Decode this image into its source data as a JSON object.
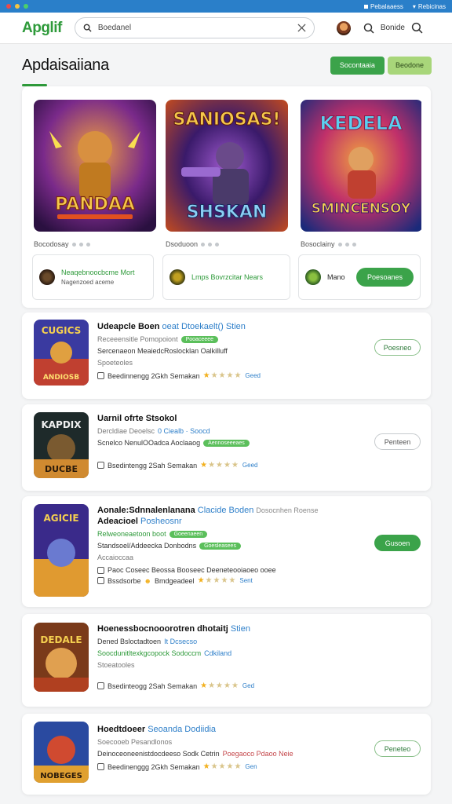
{
  "status_bar": {
    "dot_colors": [
      "#e94b4b",
      "#f5c542",
      "#4bcf6b"
    ],
    "right_items": [
      "Pebalaaess",
      "Rebicinas"
    ]
  },
  "topbar": {
    "logo": "Apglif",
    "search_value": "Boedanel",
    "account_label": "Bonide"
  },
  "page": {
    "title": "Apdaisaiiana",
    "primary_button": "Socontaaia",
    "secondary_button": "Beodone"
  },
  "featured": {
    "items": [
      {
        "banner_top": "",
        "banner_bottom": "PANDAA",
        "banner_sub": "",
        "caption": "Bocodosay",
        "sub_title": "Neaqebnoocbcme Mort",
        "sub_desc": "Nagenzoed aceme",
        "palette": [
          "#5a2a8a",
          "#e08a2a"
        ]
      },
      {
        "banner_top": "SANIOSAS!",
        "banner_bottom": "SHSKAN",
        "banner_sub": "",
        "caption": "Dsoduoon",
        "sub_title": "Lmps Bovrzcitar Nears",
        "sub_desc": "",
        "palette": [
          "#2a1a5a",
          "#c04a2a"
        ]
      },
      {
        "banner_top": "KEDELA",
        "banner_bottom": "SMINCENSOY",
        "banner_sub": "",
        "caption": "Bosoclainy",
        "sub_title": "Mano",
        "sub_desc": "",
        "install_label": "Poesoanes",
        "palette": [
          "#1a3a8a",
          "#c0305a"
        ]
      }
    ]
  },
  "apps": [
    {
      "name": "Udeapcle Boen",
      "name_extra": "oeat Dtoekaelt() Stien",
      "line1": "Receeensitle Pomopoiont",
      "pill1": "Pooaceeee",
      "line2": "Sercenaeon MeaiedcRoslocklan Oalkilluff",
      "line3": "Spoeteoles",
      "meta": "Beedinnengg 2Gkh Semakan",
      "stars_full": 1,
      "rating_text": "Geed",
      "install": "Poesneo",
      "install_style": "outline",
      "icon_text": "CUGICS",
      "icon_sub": "ANDIOSB",
      "palette": [
        "#2a3a8a",
        "#d04030"
      ]
    },
    {
      "name": "Uarnil ofrte Stsokol",
      "name_extra": "",
      "line1": "Dercldiae Deoelsc",
      "line1_blue": "0 Ciealb · Soocd",
      "line2": "Scnelco NenulOOadca Aoclaaog",
      "pill2": "Aennoseeeaes",
      "line3": "",
      "meta": "Bsedintengg 2Sah Semakan",
      "stars_full": 1,
      "rating_text": "Geed",
      "install": "Penteen",
      "install_style": "outline-gray",
      "icon_text": "KAPDIX",
      "icon_sub": "DUCBE",
      "palette": [
        "#1a2a2a",
        "#d08a30"
      ]
    },
    {
      "name": "Aonale:Sdnnalenlanana",
      "name_extra": "Clacide Boden",
      "name_grey": "Dosocnhen Roense",
      "name2": "Adeacioel",
      "name2_extra": "Posheosnr",
      "line1": "Relweoneaetoon boot",
      "pill1": "Goeenaeen",
      "line2": "Standsoel/Addeecka Donbodns",
      "pill2": "Goesleasees",
      "line3": "Accaioccaa",
      "meta": "Paoc Coseec Beossa Booseec Deeneteooiaoeo ooee",
      "meta2": "Bssdsorbe",
      "meta2_b": "Bmdgeadeel",
      "stars_full": 1,
      "rating_text": "Sent",
      "install": "Gusoen",
      "install_style": "fill",
      "icon_text": "AGICIE",
      "icon_sub": "",
      "palette": [
        "#3a2a8a",
        "#e09a30"
      ]
    },
    {
      "name": "Hoenessbocnooorotren dhotaitj",
      "name_extra": "Stien",
      "line1": "Dened Bsloctadtoen",
      "line1_blue": "It Dcsecso",
      "line2": "Soocdunitltexkgcopock Sodoccm",
      "line2_blue": "Cdkiland",
      "line3": "Stoeatooles",
      "meta": "Bsedinteogg 2Sah Semakan",
      "stars_full": 1,
      "rating_text": "Ged",
      "install": "",
      "install_style": "none",
      "icon_text": "DEDALE",
      "icon_sub": "",
      "palette": [
        "#8a3a1a",
        "#e0b040"
      ]
    },
    {
      "name": "Hoedtdoeer",
      "name_extra": "Seoanda Dodiidia",
      "line1": "Soecooeb Pesandlonos",
      "line1_blue": "",
      "line2": "Deinoceoneenistdocdeeso Sodk Cetrin",
      "line2_red": "Poegaoco Pdaoo Neie",
      "line3": "",
      "meta": "Beedinenggg 2Gkh Semakan",
      "stars_full": 1,
      "rating_text": "Gen",
      "install": "Peneteo",
      "install_style": "outline",
      "icon_text": "NOBEGES",
      "icon_sub": "",
      "palette": [
        "#2a4aa0",
        "#d04a30"
      ]
    }
  ]
}
